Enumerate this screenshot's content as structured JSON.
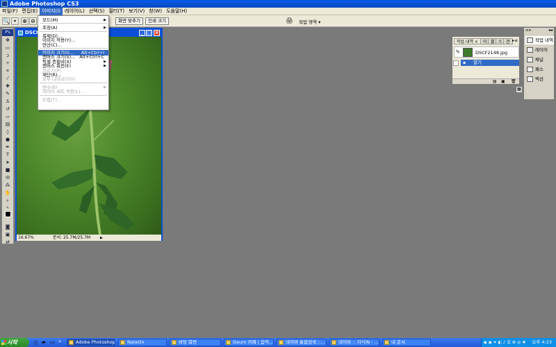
{
  "app": {
    "title": "Adobe Photoshop CS3"
  },
  "menu": [
    {
      "label": "파일(F)"
    },
    {
      "label": "편집(E)"
    },
    {
      "label": "이미지(I)",
      "active": true
    },
    {
      "label": "레이어(L)"
    },
    {
      "label": "선택(S)"
    },
    {
      "label": "필터(T)"
    },
    {
      "label": "보기(V)"
    },
    {
      "label": "창(W)"
    },
    {
      "label": "도움말(H)"
    }
  ],
  "options": {
    "fit_screen": "화면 맞추기",
    "print_size": "인쇄 크기",
    "workspace": "작업 영역 ▾"
  },
  "image_menu": [
    {
      "label": "모드(M)",
      "submenu": true
    },
    {
      "sep": true
    },
    {
      "label": "조정(A)",
      "submenu": true
    },
    {
      "sep": true
    },
    {
      "label": "복제(D)..."
    },
    {
      "label": "이미지 적용(Y)..."
    },
    {
      "label": "연산(C)..."
    },
    {
      "sep": true
    },
    {
      "label": "이미지 크기(I)...",
      "shortcut": "Alt+Ctrl+I",
      "highlight": true
    },
    {
      "label": "캔버스 크기(S)...",
      "shortcut": "Alt+Ctrl+C"
    },
    {
      "label": "픽셀 종횡비(X)",
      "submenu": true
    },
    {
      "label": "캔버스 회전(E)",
      "submenu": true
    },
    {
      "label": "자르기(P)",
      "disabled": true
    },
    {
      "label": "재단(R)..."
    },
    {
      "label": "모두 나타내기(V)",
      "disabled": true
    },
    {
      "sep": true
    },
    {
      "label": "변수(B)",
      "submenu": true,
      "disabled": true
    },
    {
      "label": "데이터 세트 적용(L)...",
      "disabled": true
    },
    {
      "sep": true
    },
    {
      "label": "트랩(T)...",
      "disabled": true
    }
  ],
  "document": {
    "title": "DSCF",
    "zoom": "16.67%",
    "doc_info": "문서: 25.7M/25.7M"
  },
  "history_panel": {
    "tabs": [
      "작업 내역 ×",
      "이",
      "블",
      "스",
      "견"
    ],
    "snapshot": "DSCF2148.jpg",
    "step": "열기"
  },
  "dock": [
    {
      "label": "작업 내역"
    },
    {
      "label": "레이어"
    },
    {
      "label": "채널"
    },
    {
      "label": "패스"
    },
    {
      "label": "액션"
    }
  ],
  "taskbar": {
    "start": "시작",
    "tasks": [
      {
        "label": "Adobe Photoshop ...",
        "active": true
      },
      {
        "label": "NateOn"
      },
      {
        "label": "바탕 화면"
      },
      {
        "label": "Daum 카페 | 음악..."
      },
      {
        "label": "네이버 통합검색 ::..."
      },
      {
        "label": "네이버 :: 지식iN - ..."
      },
      {
        "label": "내 문서"
      }
    ],
    "clock": "오후 4:23"
  }
}
